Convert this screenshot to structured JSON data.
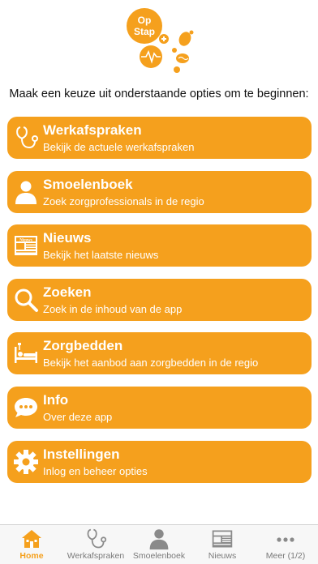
{
  "logo": {
    "line1": "Op",
    "line2": "Stap"
  },
  "intro": "Maak een keuze uit onderstaande opties om te beginnen:",
  "colors": {
    "accent": "#f5a01d",
    "white": "#ffffff",
    "tab_inactive": "#7a7a7a"
  },
  "menu": [
    {
      "icon": "stethoscope-icon",
      "title": "Werkafspraken",
      "subtitle": "Bekijk de actuele werkafspraken"
    },
    {
      "icon": "person-icon",
      "title": "Smoelenboek",
      "subtitle": "Zoek zorgprofessionals in de regio"
    },
    {
      "icon": "newspaper-icon",
      "title": "Nieuws",
      "subtitle": "Bekijk het laatste nieuws"
    },
    {
      "icon": "search-icon",
      "title": "Zoeken",
      "subtitle": "Zoek in de inhoud van de app"
    },
    {
      "icon": "bed-icon",
      "title": "Zorgbedden",
      "subtitle": "Bekijk het aanbod aan zorgbedden in de regio"
    },
    {
      "icon": "info-bubble-icon",
      "title": "Info",
      "subtitle": "Over deze app"
    },
    {
      "icon": "gear-icon",
      "title": "Instellingen",
      "subtitle": "Inlog en beheer opties"
    }
  ],
  "tabs": [
    {
      "icon": "home-icon",
      "label": "Home",
      "active": true
    },
    {
      "icon": "stethoscope-icon",
      "label": "Werkafspraken",
      "active": false
    },
    {
      "icon": "person-icon",
      "label": "Smoelenboek",
      "active": false
    },
    {
      "icon": "newspaper-icon",
      "label": "Nieuws",
      "active": false
    },
    {
      "icon": "more-icon",
      "label": "Meer (1/2)",
      "active": false
    }
  ],
  "newspaper_masthead": "Nieuws"
}
